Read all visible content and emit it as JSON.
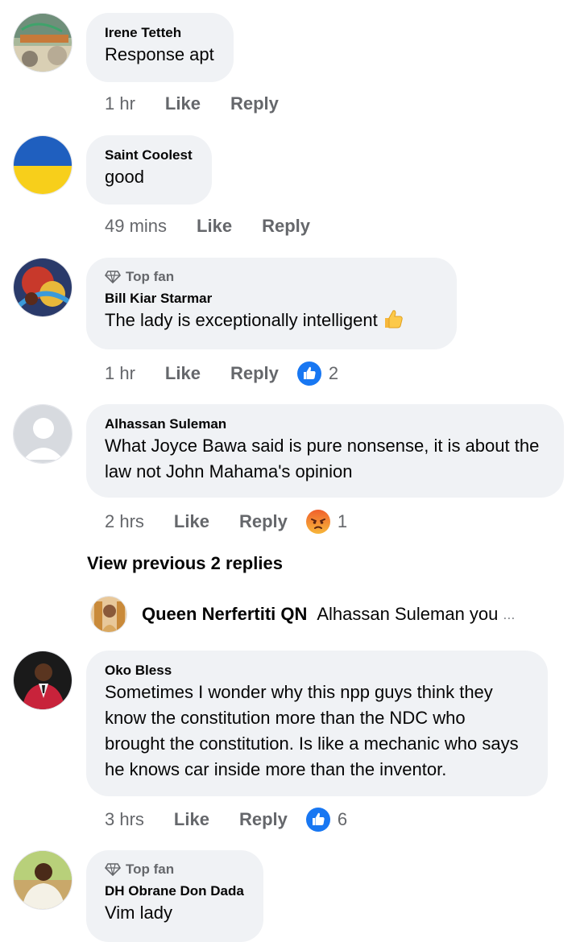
{
  "comments": [
    {
      "name": "Irene Tetteh",
      "text": "Response apt",
      "time": "1 hr",
      "like": "Like",
      "reply": "Reply",
      "avatar_icon": "landscape-photo-avatar"
    },
    {
      "name": "Saint Coolest",
      "text": "good",
      "time": "49 mins",
      "like": "Like",
      "reply": "Reply",
      "avatar_icon": "blue-yellow-flag-avatar"
    },
    {
      "badge": "Top fan",
      "name": "Bill Kiar Starmar",
      "text": "The lady is exceptionally intelligent",
      "emoji": "thumbs-up-emoji",
      "time": "1 hr",
      "like": "Like",
      "reply": "Reply",
      "reaction_icon": "like-reaction-icon",
      "reaction_count": "2",
      "avatar_icon": "abstract-art-avatar"
    },
    {
      "name": "Alhassan Suleman",
      "text": "What Joyce Bawa said is pure nonsense, it is about the law not John Mahama's opinion",
      "time": "2 hrs",
      "like": "Like",
      "reply": "Reply",
      "reaction_icon": "angry-reaction-icon",
      "reaction_count": "1",
      "avatar_icon": "default-profile-avatar"
    },
    {
      "name": "Oko Bless",
      "text": "Sometimes I wonder why this npp guys think they know the constitution more than the NDC who brought the constitution. Is like a mechanic who says he knows car inside more than the inventor.",
      "time": "3 hrs",
      "like": "Like",
      "reply": "Reply",
      "reaction_icon": "like-reaction-icon",
      "reaction_count": "6",
      "avatar_icon": "man-in-red-suit-avatar"
    },
    {
      "badge": "Top fan",
      "name": "DH Obrane Don Dada",
      "text": "Vim lady",
      "avatar_icon": "man-in-white-shirt-avatar"
    }
  ],
  "view_previous": "View previous 2 replies",
  "reply_preview": {
    "name": "Queen Nerfertiti QN",
    "text": "Alhassan Suleman you",
    "ellipsis": "...",
    "avatar_icon": "woman-portrait-avatar"
  },
  "colors": {
    "bubble_bg": "#f0f2f5",
    "secondary_text": "#65676b",
    "like_blue": "#1877f2",
    "angry_orange": "#f0602c"
  }
}
